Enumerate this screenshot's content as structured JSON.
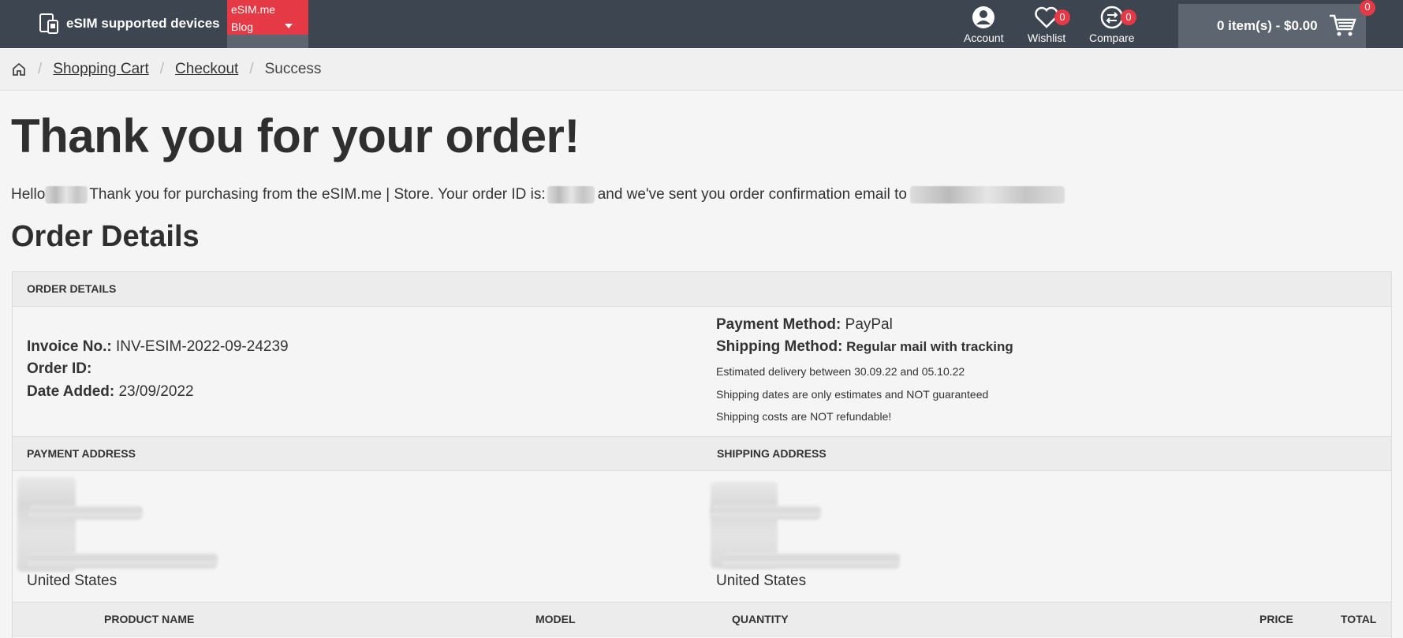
{
  "header": {
    "brand": "eSIM supported devices",
    "menu_line1": "eSIM.me",
    "menu_line2": "Blog",
    "account": "Account",
    "wishlist": "Wishlist",
    "wishlist_count": "0",
    "compare": "Compare",
    "compare_count": "0",
    "cart_text": "0 item(s) - $0.00",
    "cart_count": "0"
  },
  "breadcrumb": {
    "items": [
      "Shopping Cart",
      "Checkout",
      "Success"
    ]
  },
  "title": "Thank you for your order!",
  "message": {
    "hello": "Hello",
    "part1": "Thank you for purchasing from the eSIM.me | Store. Your order ID is:",
    "part2": "and we've sent you order confirmation email to"
  },
  "order_details_title": "Order Details",
  "order_box": {
    "header": "ORDER DETAILS",
    "invoice_label": "Invoice No.:",
    "invoice_value": "INV-ESIM-2022-09-24239",
    "order_id_label": "Order ID:",
    "date_label": "Date Added:",
    "date_value": "23/09/2022",
    "payment_method_label": "Payment Method:",
    "payment_method_value": "PayPal",
    "shipping_method_label": "Shipping Method:",
    "shipping_method_value": "Regular mail with tracking",
    "note1": "Estimated delivery between 30.09.22 and 05.10.22",
    "note2": "Shipping dates are only estimates and NOT guaranteed",
    "note3": "Shipping costs are NOT refundable!"
  },
  "addresses": {
    "payment_header": "PAYMENT ADDRESS",
    "shipping_header": "SHIPPING ADDRESS",
    "payment_country": "United States",
    "shipping_country": "United States"
  },
  "products": {
    "col_name": "PRODUCT NAME",
    "col_model": "MODEL",
    "col_quantity": "QUANTITY",
    "col_price": "PRICE",
    "col_total": "TOTAL"
  },
  "colors": {
    "topbar": "#3d4650",
    "accent": "#e53945",
    "cart_bg": "#5d6670"
  },
  "icons": [
    "devices-icon",
    "account-icon",
    "heart-icon",
    "compare-icon",
    "cart-icon",
    "home-icon",
    "caret-down-icon"
  ]
}
